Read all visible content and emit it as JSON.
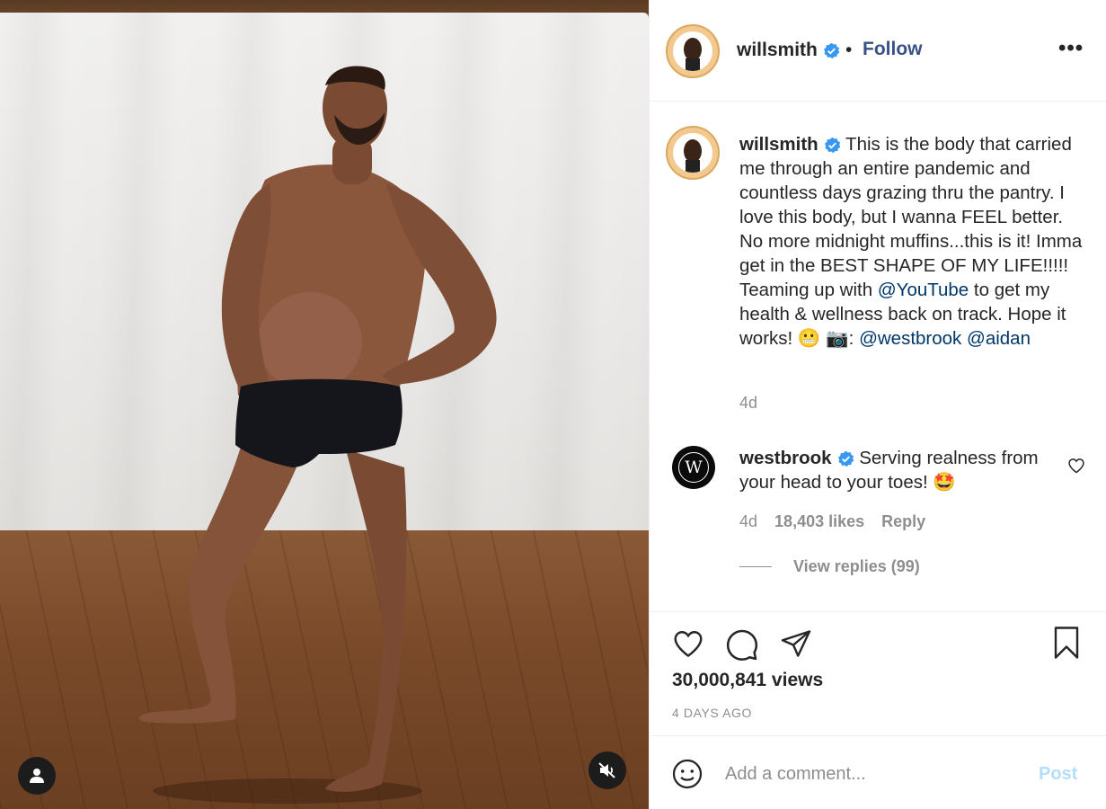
{
  "post": {
    "author": "willsmith",
    "follow_label": "Follow",
    "separator": "•",
    "more_label": "•••"
  },
  "caption": {
    "username": "willsmith",
    "text_1": "This is the body that carried me through an entire pandemic and countless days grazing thru the pantry. I love this body, but I wanna FEEL better. No more midnight muffins...this is it! Imma get in the BEST SHAPE OF MY LIFE!!!!! Teaming up with ",
    "mention_youtube": "@YouTube",
    "text_2": " to get my health & wellness back on track. Hope it works! 😬 📷: ",
    "mention_westbrook": "@westbrook",
    "mention_aidan": "@aidan",
    "time": "4d"
  },
  "comment": {
    "username": "westbrook",
    "avatar_letter": "W",
    "text": "Serving realness from your head to your toes! 🤩",
    "time": "4d",
    "likes": "18,403 likes",
    "reply_label": "Reply",
    "view_replies": "View replies (99)"
  },
  "stats": {
    "views": "30,000,841 views",
    "posted_ago": "4 DAYS AGO"
  },
  "composer": {
    "placeholder": "Add a comment...",
    "post_label": "Post"
  },
  "colors": {
    "link": "#00376b",
    "follow": "#385185",
    "verified": "#3897f0",
    "post_disabled": "#b2dffc",
    "muted": "#8e8e8e"
  },
  "icons": {
    "user_tag": "person-icon",
    "mute": "speaker-muted-icon",
    "like": "heart-icon",
    "comment": "speech-bubble-icon",
    "share": "paper-plane-icon",
    "save": "bookmark-icon",
    "emoji": "smiley-icon",
    "more": "more-options-icon",
    "verified": "verified-badge-icon"
  }
}
